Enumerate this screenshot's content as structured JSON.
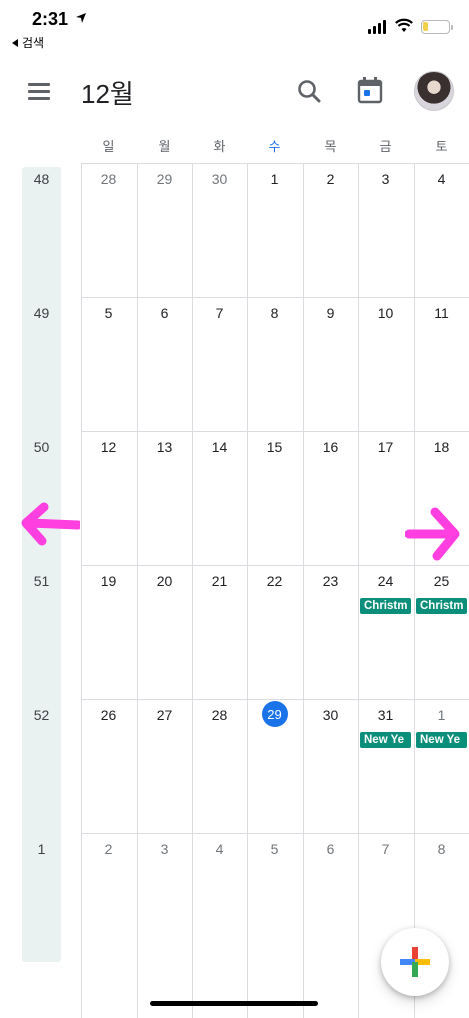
{
  "status_bar": {
    "time": "2:31",
    "back_label": "검색"
  },
  "app_bar": {
    "title": "12월",
    "menu_icon": "menu-icon",
    "search_icon": "search-icon",
    "today_icon": "calendar-today-icon",
    "avatar": "profile-avatar"
  },
  "weekdays": [
    {
      "label": "일",
      "today": false
    },
    {
      "label": "월",
      "today": false
    },
    {
      "label": "화",
      "today": false
    },
    {
      "label": "수",
      "today": true
    },
    {
      "label": "목",
      "today": false
    },
    {
      "label": "금",
      "today": false
    },
    {
      "label": "토",
      "today": false
    }
  ],
  "weeks": [
    {
      "number": "48",
      "days": [
        {
          "d": "28",
          "muted": true
        },
        {
          "d": "29",
          "muted": true
        },
        {
          "d": "30",
          "muted": true
        },
        {
          "d": "1"
        },
        {
          "d": "2"
        },
        {
          "d": "3"
        },
        {
          "d": "4"
        }
      ]
    },
    {
      "number": "49",
      "days": [
        {
          "d": "5"
        },
        {
          "d": "6"
        },
        {
          "d": "7"
        },
        {
          "d": "8"
        },
        {
          "d": "9"
        },
        {
          "d": "10"
        },
        {
          "d": "11"
        }
      ]
    },
    {
      "number": "50",
      "days": [
        {
          "d": "12"
        },
        {
          "d": "13"
        },
        {
          "d": "14"
        },
        {
          "d": "15"
        },
        {
          "d": "16"
        },
        {
          "d": "17"
        },
        {
          "d": "18"
        }
      ]
    },
    {
      "number": "51",
      "days": [
        {
          "d": "19"
        },
        {
          "d": "20"
        },
        {
          "d": "21"
        },
        {
          "d": "22"
        },
        {
          "d": "23"
        },
        {
          "d": "24",
          "event": "Christm"
        },
        {
          "d": "25",
          "event": "Christm"
        }
      ]
    },
    {
      "number": "52",
      "days": [
        {
          "d": "26"
        },
        {
          "d": "27"
        },
        {
          "d": "28"
        },
        {
          "d": "29",
          "today": true
        },
        {
          "d": "30"
        },
        {
          "d": "31",
          "event": "New Ye"
        },
        {
          "d": "1",
          "muted": true,
          "event": "New Ye"
        }
      ]
    },
    {
      "number": "1",
      "days": [
        {
          "d": "2",
          "muted": true
        },
        {
          "d": "3",
          "muted": true
        },
        {
          "d": "4",
          "muted": true
        },
        {
          "d": "5",
          "muted": true
        },
        {
          "d": "6",
          "muted": true
        },
        {
          "d": "7",
          "muted": true
        },
        {
          "d": "8",
          "muted": true
        }
      ]
    }
  ],
  "colors": {
    "accent": "#1a73e8",
    "event": "#0b8f7a",
    "week_strip": "#e9f2f1",
    "annotation_arrows": "#ff3fe0"
  },
  "fab": {
    "icon": "plus-icon"
  }
}
